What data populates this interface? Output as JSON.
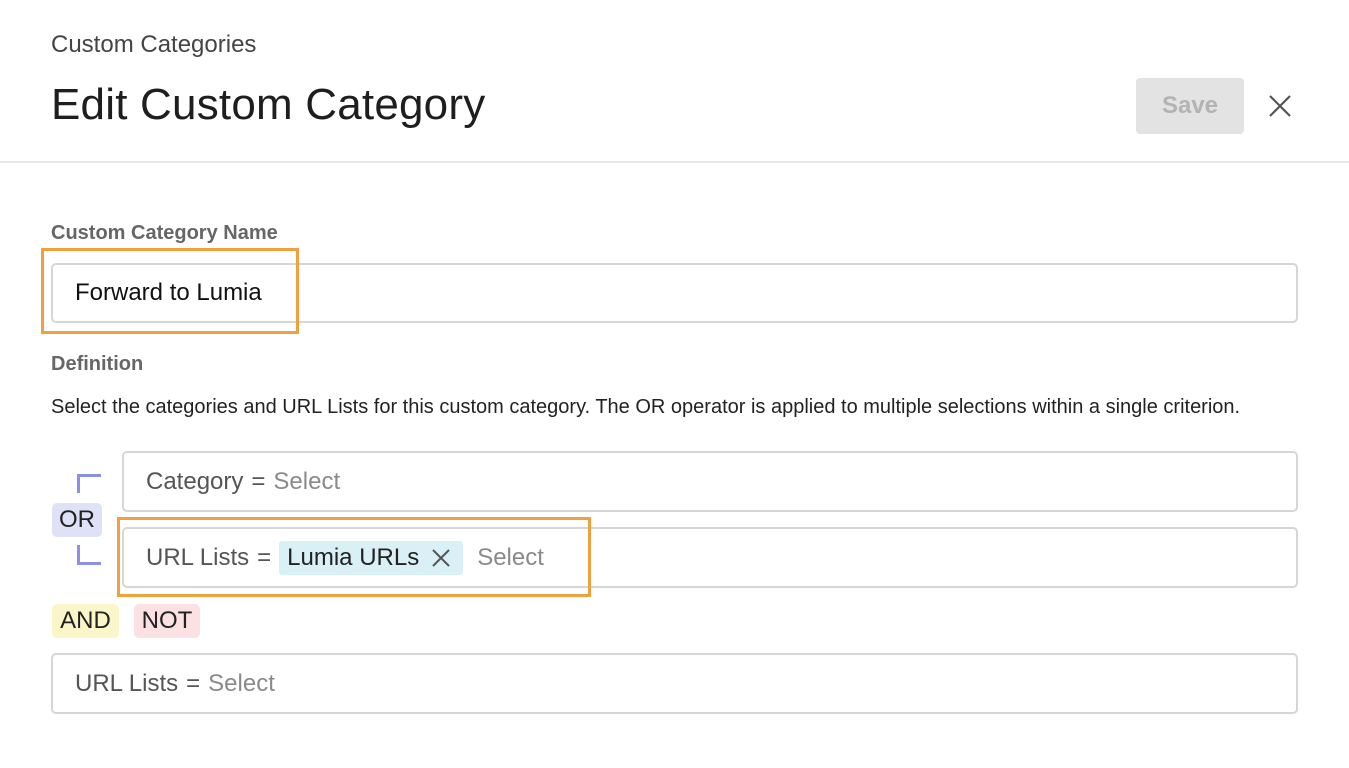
{
  "header": {
    "breadcrumb": "Custom Categories",
    "title": "Edit Custom Category",
    "save_label": "Save",
    "close_icon": "close-icon"
  },
  "form": {
    "name_label": "Custom Category Name",
    "name_value": "Forward to Lumia",
    "definition_label": "Definition",
    "definition_description": "Select the categories and URL Lists for this custom category. The OR operator is applied to multiple selections within a single criterion."
  },
  "operators": {
    "or": "OR",
    "and": "AND",
    "not": "NOT"
  },
  "criteria": [
    {
      "key": "Category",
      "eq": "=",
      "placeholder": "Select",
      "chips": []
    },
    {
      "key": "URL Lists",
      "eq": "=",
      "placeholder": "Select",
      "chips": [
        {
          "label": "Lumia URLs",
          "remove_icon": "close-icon"
        }
      ]
    },
    {
      "key": "URL Lists",
      "eq": "=",
      "placeholder": "Select",
      "chips": []
    }
  ],
  "colors": {
    "highlight": "#f0a03c",
    "or_bg": "#dfe2f7",
    "and_bg": "#fbf6c9",
    "not_bg": "#fbe1e1",
    "chip_bg": "#d8f0f6",
    "bracket": "#8b8fe6"
  }
}
